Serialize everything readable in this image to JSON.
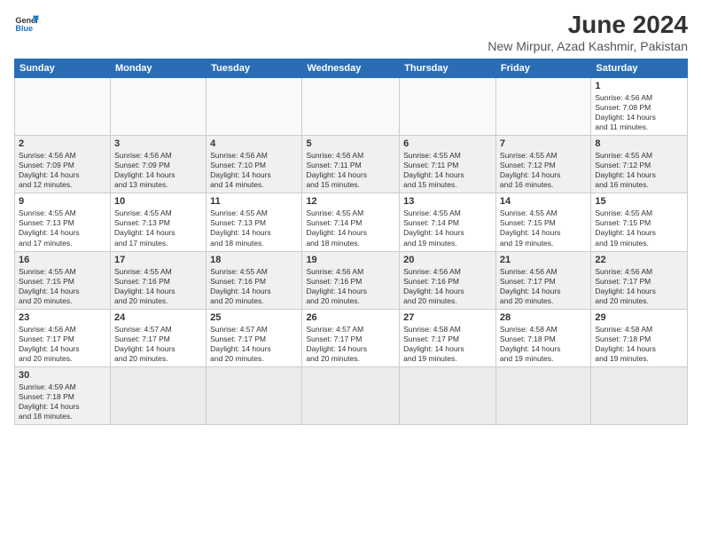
{
  "logo": {
    "line1": "General",
    "line2": "Blue"
  },
  "title": "June 2024",
  "subtitle": "New Mirpur, Azad Kashmir, Pakistan",
  "days_header": [
    "Sunday",
    "Monday",
    "Tuesday",
    "Wednesday",
    "Thursday",
    "Friday",
    "Saturday"
  ],
  "weeks": [
    {
      "shaded": false,
      "days": [
        {
          "num": "",
          "info": ""
        },
        {
          "num": "",
          "info": ""
        },
        {
          "num": "",
          "info": ""
        },
        {
          "num": "",
          "info": ""
        },
        {
          "num": "",
          "info": ""
        },
        {
          "num": "",
          "info": ""
        },
        {
          "num": "1",
          "info": "Sunrise: 4:56 AM\nSunset: 7:08 PM\nDaylight: 14 hours\nand 11 minutes."
        }
      ]
    },
    {
      "shaded": true,
      "days": [
        {
          "num": "2",
          "info": "Sunrise: 4:56 AM\nSunset: 7:09 PM\nDaylight: 14 hours\nand 12 minutes."
        },
        {
          "num": "3",
          "info": "Sunrise: 4:56 AM\nSunset: 7:09 PM\nDaylight: 14 hours\nand 13 minutes."
        },
        {
          "num": "4",
          "info": "Sunrise: 4:56 AM\nSunset: 7:10 PM\nDaylight: 14 hours\nand 14 minutes."
        },
        {
          "num": "5",
          "info": "Sunrise: 4:56 AM\nSunset: 7:11 PM\nDaylight: 14 hours\nand 15 minutes."
        },
        {
          "num": "6",
          "info": "Sunrise: 4:55 AM\nSunset: 7:11 PM\nDaylight: 14 hours\nand 15 minutes."
        },
        {
          "num": "7",
          "info": "Sunrise: 4:55 AM\nSunset: 7:12 PM\nDaylight: 14 hours\nand 16 minutes."
        },
        {
          "num": "8",
          "info": "Sunrise: 4:55 AM\nSunset: 7:12 PM\nDaylight: 14 hours\nand 16 minutes."
        }
      ]
    },
    {
      "shaded": false,
      "days": [
        {
          "num": "9",
          "info": "Sunrise: 4:55 AM\nSunset: 7:13 PM\nDaylight: 14 hours\nand 17 minutes."
        },
        {
          "num": "10",
          "info": "Sunrise: 4:55 AM\nSunset: 7:13 PM\nDaylight: 14 hours\nand 17 minutes."
        },
        {
          "num": "11",
          "info": "Sunrise: 4:55 AM\nSunset: 7:13 PM\nDaylight: 14 hours\nand 18 minutes."
        },
        {
          "num": "12",
          "info": "Sunrise: 4:55 AM\nSunset: 7:14 PM\nDaylight: 14 hours\nand 18 minutes."
        },
        {
          "num": "13",
          "info": "Sunrise: 4:55 AM\nSunset: 7:14 PM\nDaylight: 14 hours\nand 19 minutes."
        },
        {
          "num": "14",
          "info": "Sunrise: 4:55 AM\nSunset: 7:15 PM\nDaylight: 14 hours\nand 19 minutes."
        },
        {
          "num": "15",
          "info": "Sunrise: 4:55 AM\nSunset: 7:15 PM\nDaylight: 14 hours\nand 19 minutes."
        }
      ]
    },
    {
      "shaded": true,
      "days": [
        {
          "num": "16",
          "info": "Sunrise: 4:55 AM\nSunset: 7:15 PM\nDaylight: 14 hours\nand 20 minutes."
        },
        {
          "num": "17",
          "info": "Sunrise: 4:55 AM\nSunset: 7:16 PM\nDaylight: 14 hours\nand 20 minutes."
        },
        {
          "num": "18",
          "info": "Sunrise: 4:55 AM\nSunset: 7:16 PM\nDaylight: 14 hours\nand 20 minutes."
        },
        {
          "num": "19",
          "info": "Sunrise: 4:56 AM\nSunset: 7:16 PM\nDaylight: 14 hours\nand 20 minutes."
        },
        {
          "num": "20",
          "info": "Sunrise: 4:56 AM\nSunset: 7:16 PM\nDaylight: 14 hours\nand 20 minutes."
        },
        {
          "num": "21",
          "info": "Sunrise: 4:56 AM\nSunset: 7:17 PM\nDaylight: 14 hours\nand 20 minutes."
        },
        {
          "num": "22",
          "info": "Sunrise: 4:56 AM\nSunset: 7:17 PM\nDaylight: 14 hours\nand 20 minutes."
        }
      ]
    },
    {
      "shaded": false,
      "days": [
        {
          "num": "23",
          "info": "Sunrise: 4:56 AM\nSunset: 7:17 PM\nDaylight: 14 hours\nand 20 minutes."
        },
        {
          "num": "24",
          "info": "Sunrise: 4:57 AM\nSunset: 7:17 PM\nDaylight: 14 hours\nand 20 minutes."
        },
        {
          "num": "25",
          "info": "Sunrise: 4:57 AM\nSunset: 7:17 PM\nDaylight: 14 hours\nand 20 minutes."
        },
        {
          "num": "26",
          "info": "Sunrise: 4:57 AM\nSunset: 7:17 PM\nDaylight: 14 hours\nand 20 minutes."
        },
        {
          "num": "27",
          "info": "Sunrise: 4:58 AM\nSunset: 7:17 PM\nDaylight: 14 hours\nand 19 minutes."
        },
        {
          "num": "28",
          "info": "Sunrise: 4:58 AM\nSunset: 7:18 PM\nDaylight: 14 hours\nand 19 minutes."
        },
        {
          "num": "29",
          "info": "Sunrise: 4:58 AM\nSunset: 7:18 PM\nDaylight: 14 hours\nand 19 minutes."
        }
      ]
    },
    {
      "shaded": true,
      "days": [
        {
          "num": "30",
          "info": "Sunrise: 4:59 AM\nSunset: 7:18 PM\nDaylight: 14 hours\nand 18 minutes."
        },
        {
          "num": "",
          "info": ""
        },
        {
          "num": "",
          "info": ""
        },
        {
          "num": "",
          "info": ""
        },
        {
          "num": "",
          "info": ""
        },
        {
          "num": "",
          "info": ""
        },
        {
          "num": "",
          "info": ""
        }
      ]
    }
  ]
}
